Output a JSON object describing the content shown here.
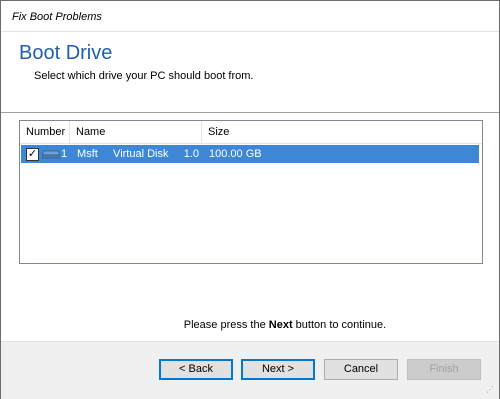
{
  "window": {
    "title": "Fix Boot Problems"
  },
  "header": {
    "title": "Boot Drive",
    "subtitle": "Select which drive your PC should boot from."
  },
  "list": {
    "columns": {
      "number": "Number",
      "name": "Name",
      "size": "Size"
    },
    "rows": [
      {
        "checked": "✓",
        "number": "1",
        "name": "Msft     Virtual Disk     1.0",
        "size": "100.00 GB",
        "icon": "drive-icon"
      }
    ]
  },
  "instruction": {
    "prefix": "Please press the ",
    "emphasis": "Next",
    "suffix": " button to continue."
  },
  "buttons": {
    "back": "< Back",
    "next": "Next >",
    "cancel": "Cancel",
    "finish": "Finish"
  },
  "colors": {
    "accent": "#1e5fae",
    "selection": "#3e87d6",
    "button_focus": "#0078d7"
  }
}
